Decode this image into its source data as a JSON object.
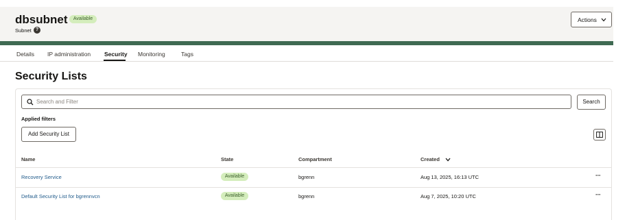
{
  "resource": {
    "name": "dbsubnet",
    "status": "Available",
    "type": "Subnet",
    "help": "?",
    "actions_label": "Actions"
  },
  "tabs": [
    {
      "label": "Details"
    },
    {
      "label": "IP administration"
    },
    {
      "label": "Security",
      "active": true
    },
    {
      "label": "Monitoring"
    },
    {
      "label": "Tags"
    }
  ],
  "section": {
    "title": "Security Lists"
  },
  "search": {
    "placeholder": "Search and Filter",
    "value": "",
    "button_label": "Search"
  },
  "filters": {
    "applied_label": "Applied filters"
  },
  "toolbar": {
    "add_label": "Add Security List"
  },
  "table": {
    "columns": [
      "Name",
      "State",
      "Compartment",
      "Created"
    ],
    "sorted_column": "Created",
    "rows": [
      {
        "name": "Recovery Service",
        "state": "Available",
        "compartment": "bgrenn",
        "created": "Aug 13, 2025, 16:13 UTC",
        "menu": "···"
      },
      {
        "name": "Default Security List for bgrennvcn",
        "state": "Available",
        "compartment": "bgrenn",
        "created": "Aug 7, 2025, 10:20 UTC",
        "menu": "···"
      }
    ]
  },
  "colors": {
    "accent_green_badge": "#d4edbc",
    "badge_text": "#3b5f2b",
    "link": "#1f5a8a",
    "banner": "#3f6a52"
  },
  "icons": {
    "help": "help-icon",
    "actions": "chevron-down-icon",
    "search": "search-icon",
    "columns": "columns-icon",
    "sort": "sort-desc-icon",
    "row_menu": "more-horizontal-icon"
  }
}
